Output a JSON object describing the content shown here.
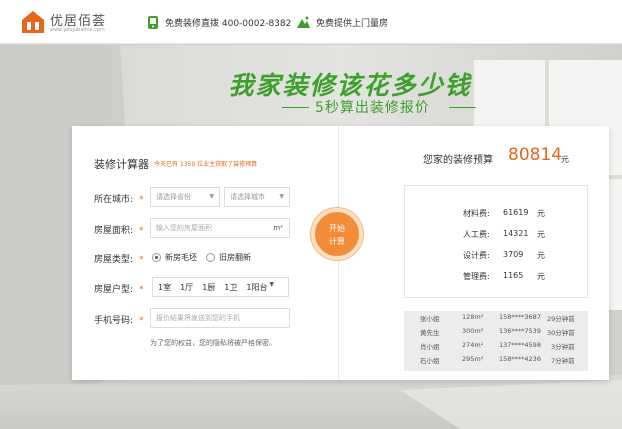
{
  "header": {
    "logo_name": "优居佰荟",
    "logo_url": "www.youjubaihui.com",
    "hotline": "免费装修直拨 400-0002-8382",
    "measure": "免费提供上门量房"
  },
  "banner": {
    "headline": "我家装修该花多少钱",
    "subline": "5秒算出装修报价"
  },
  "calculator": {
    "title": "装修计算器",
    "note": "今天已有 1359 位业主获取了装修预算",
    "city_label": "所在城市:",
    "province_placeholder": "请选择省份",
    "city_placeholder": "请选择城市",
    "area_label": "房屋面积:",
    "area_placeholder": "输入您的房屋面积",
    "area_unit": "m²",
    "type_label": "房屋类型:",
    "type_options": [
      "新房毛坯",
      "旧房翻新"
    ],
    "layout_label": "房屋户型:",
    "layout_values": [
      "1室",
      "1厅",
      "1厨",
      "1卫",
      "1阳台"
    ],
    "phone_label": "手机号码:",
    "phone_placeholder": "报价结果将发送到您的手机",
    "privacy": "为了您的权益，您的隐私将被严格保密。",
    "required_mark": "*",
    "start_line1": "开始",
    "start_line2": "计算"
  },
  "result": {
    "budget_label": "您家的装修预算",
    "budget_value": "80814",
    "budget_unit": "元",
    "costs": [
      {
        "label": "材料费:",
        "value": "61619",
        "unit": "元"
      },
      {
        "label": "人工费:",
        "value": "14321",
        "unit": "元"
      },
      {
        "label": "设计费:",
        "value": "3709",
        "unit": "元"
      },
      {
        "label": "管理费:",
        "value": "1165",
        "unit": "元"
      }
    ],
    "records": [
      {
        "name": "张小姐",
        "area": "128m²",
        "phone": "158****3687",
        "time": "29分钟前"
      },
      {
        "name": "黄先生",
        "area": "300m²",
        "phone": "136****7539",
        "time": "30分钟前"
      },
      {
        "name": "肖小姐",
        "area": "274m²",
        "phone": "137****4598",
        "time": "3分钟前"
      },
      {
        "name": "石小姐",
        "area": "295m²",
        "phone": "158****4236",
        "time": "7分钟前"
      }
    ]
  },
  "colors": {
    "brand_orange": "#e8651c",
    "brand_green": "#3e9f2d",
    "button_orange": "#f18d38"
  },
  "icons": [
    "house-logo-icon",
    "phone-icon",
    "measure-house-icon",
    "chevron-down-icon"
  ]
}
